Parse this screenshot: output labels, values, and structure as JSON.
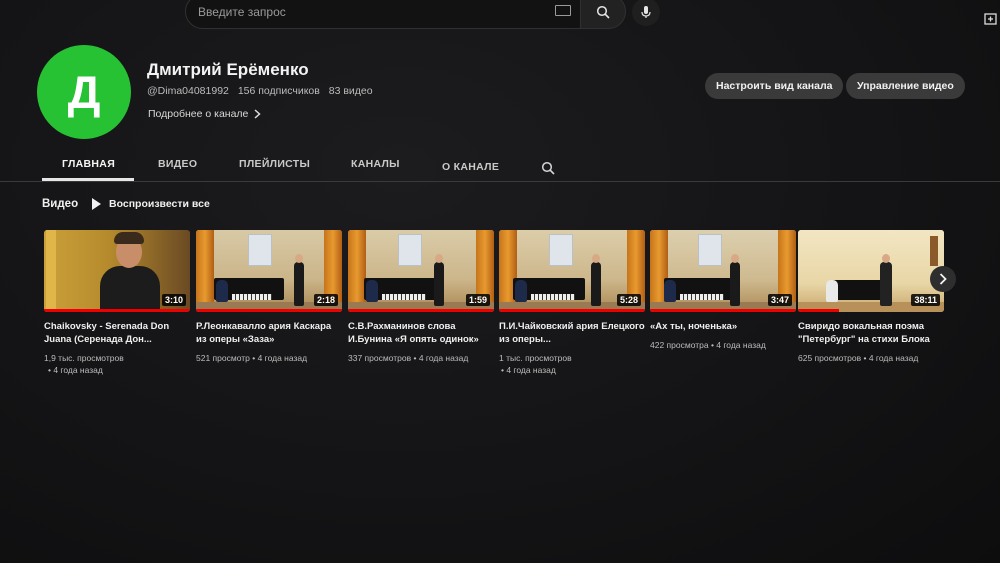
{
  "search": {
    "placeholder": "Введите запрос"
  },
  "channel": {
    "avatar_letter": "Д",
    "avatar_color": "#27c234",
    "name": "Дмитрий Ерёменко",
    "handle": "@Dima04081992",
    "subscribers": "156 подписчиков",
    "video_count": "83 видео",
    "more_label": "Подробнее о канале"
  },
  "header_buttons": {
    "customize": "Настроить вид канала",
    "manage": "Управление видео"
  },
  "tabs": [
    {
      "label": "ГЛАВНАЯ",
      "active": true
    },
    {
      "label": "ВИДЕО",
      "active": false
    },
    {
      "label": "ПЛЕЙЛИСТЫ",
      "active": false
    },
    {
      "label": "КАНАЛЫ",
      "active": false
    },
    {
      "label": "О КАНАЛЕ",
      "active": false
    }
  ],
  "section": {
    "title": "Видео",
    "play_all": "Воспроизвести все"
  },
  "videos": [
    {
      "title": "Chaikovsky - Serenada Don Juana (Серенада Дон...",
      "duration": "3:10",
      "views": "1,9 тыс. просмотров",
      "age": "• 4 года назад"
    },
    {
      "title": "Р.Леонкавалло ария Каскара из оперы «Заза»",
      "duration": "2:18",
      "views": "521 просмотр",
      "age": "• 4 года назад"
    },
    {
      "title": "С.В.Рахманинов слова И.Бунина «Я опять одинок»",
      "duration": "1:59",
      "views": "337 просмотров",
      "age": "• 4 года назад"
    },
    {
      "title": "П.И.Чайковский ария Елецкого из оперы...",
      "duration": "5:28",
      "views": "1 тыс. просмотров",
      "age": "• 4 года назад"
    },
    {
      "title": "«Ах ты, ноченька»",
      "duration": "3:47",
      "views": "422 просмотра",
      "age": "• 4 года назад"
    },
    {
      "title": "Свиридо вокальная поэма \"Петербург\" на стихи Блока",
      "duration": "38:11",
      "views": "625 просмотров",
      "age": "• 4 года назад"
    }
  ],
  "colors": {
    "accent_red": "#ee0000",
    "avatar_green": "#27c234"
  }
}
